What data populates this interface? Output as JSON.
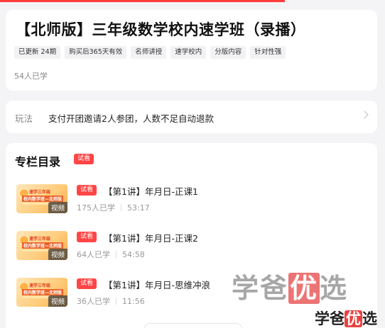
{
  "progress": 0.74,
  "course": {
    "title": "【北师版】三年级数学校内速学班（录播）",
    "tags": [
      "已更新 24期",
      "购买后365天有效",
      "名师讲授",
      "速学校内",
      "分版内容",
      "针对性强"
    ],
    "learners": "54人已学"
  },
  "rule": {
    "label": "玩法",
    "text": "支付开团邀请2人参团，人数不足自动退款"
  },
  "catalog": {
    "title": "专栏目录",
    "badge": "试看",
    "lessons": [
      {
        "badge": "试看",
        "title": "【第1讲】年月日-正课1",
        "learners": "175人已学",
        "duration": "53:17",
        "video_label": "视频"
      },
      {
        "badge": "试看",
        "title": "【第1讲】年月日-正课2",
        "learners": "64人已学",
        "duration": "54:58",
        "video_label": "视频"
      },
      {
        "badge": "试看",
        "title": "【第1讲】年月日-思维冲浪",
        "learners": "36人已学",
        "duration": "11:56",
        "video_label": "视频"
      }
    ],
    "thumb_text": {
      "line1": "速学三年级",
      "line2": "校内数学班—北师版"
    }
  },
  "watermark": {
    "part1": "学爸",
    "highlight": "优",
    "part2": "选"
  },
  "colors": {
    "accent": "#ff4545",
    "progress": "#ff3b3b"
  }
}
